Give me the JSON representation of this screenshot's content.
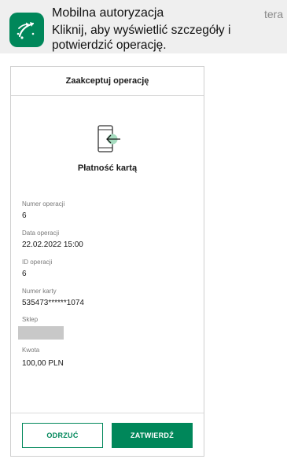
{
  "notification": {
    "app_icon": "bnp-paribas-logo-icon",
    "title": "Mobilna autoryzacja",
    "time": "tera",
    "body": "Kliknij, aby wyświetlić szczegóły i potwierdzić operację."
  },
  "screen": {
    "title": "Zaakceptuj operację",
    "icon": "phone-payment-icon",
    "payment_title": "Płatność kartą",
    "fields": [
      {
        "label": "Numer operacji",
        "value": "6"
      },
      {
        "label": "Data operacji",
        "value": "22.02.2022 15:00"
      },
      {
        "label": "ID operacji",
        "value": "6"
      },
      {
        "label": "Numer karty",
        "value": "535473******1074"
      },
      {
        "label": "Sklep",
        "value": ""
      },
      {
        "label": "Kwota",
        "value": "100,00 PLN"
      }
    ],
    "reject_label": "ODRZUĆ",
    "accept_label": "ZATWIERDŹ"
  },
  "colors": {
    "brand_green": "#00875a",
    "banner_bg": "#efefef",
    "masked": "#c8c8c8"
  }
}
